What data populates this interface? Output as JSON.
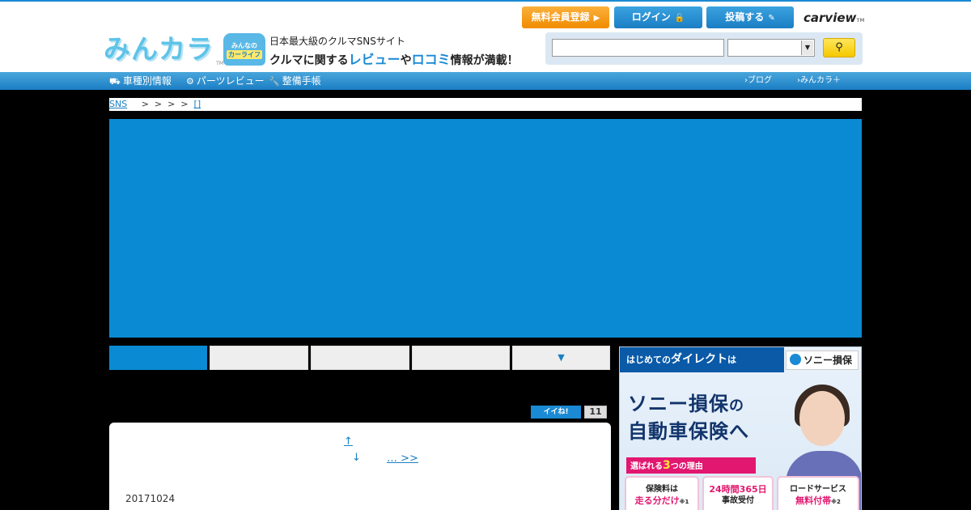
{
  "header": {
    "logo_text": "みんカラ",
    "logo_tm": "TM",
    "carlife_line1": "みんなの",
    "carlife_line2": "カーライフ",
    "tagline1": "日本最大級のクルマSNSサイト",
    "tagline2_a": "クルマに関する",
    "tagline2_b": "レビュー",
    "tagline2_c": "や",
    "tagline2_d": "ロコミ",
    "tagline2_e": "情報が満載！",
    "register_label": "無料会員登録",
    "login_label": "ログイン",
    "post_label": "投稿する",
    "carview_label": "carview",
    "carview_tm": "TM",
    "search_value": "",
    "select_value": ""
  },
  "nav": {
    "items": [
      {
        "label": "車種別情報"
      },
      {
        "label": "パーツレビュー"
      },
      {
        "label": "整備手帳"
      }
    ],
    "right": [
      {
        "label": "ブログ"
      },
      {
        "label": "みんカラ＋"
      }
    ]
  },
  "breadcrumb": {
    "root": "SNS",
    "seps": ">  >  >  >",
    "last": "[]"
  },
  "tabs": {
    "more_label": "▼"
  },
  "like": {
    "label": "イイね!",
    "count": "11"
  },
  "content": {
    "link_up": "↑",
    "link_down": "↓",
    "link_next": "… >>",
    "date": "20171024"
  },
  "ad": {
    "top_a": "はじめての",
    "top_b": "ダイレクト",
    "top_c": "は",
    "brand": "ソニー損保",
    "headline1_a": "ソニー損保",
    "headline1_b": "の",
    "headline2": "自動車保険へ",
    "reasons_a": "選ばれる",
    "reasons_b": "3",
    "reasons_c": "つの理由",
    "box1_a": "保険料は",
    "box1_b": "走る分だけ",
    "box1_note": "※1",
    "box2_a": "24時間365日",
    "box2_b": "事故受付",
    "box3_a": "ロードサービス",
    "box3_b": "無料付帯",
    "box3_note": "※2"
  },
  "colors": {
    "brand_blue": "#1a8ad4",
    "banner_blue": "#0a8ad2",
    "register_orange": "#f08c00",
    "search_yellow": "#f4c800"
  }
}
